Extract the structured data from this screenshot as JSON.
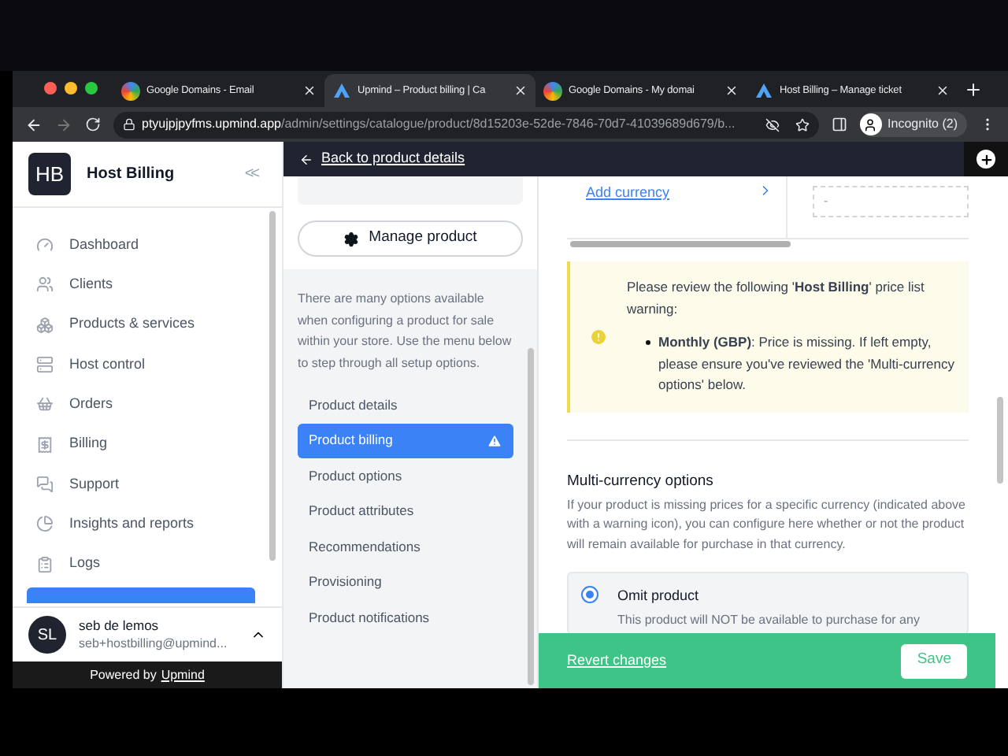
{
  "browser": {
    "tabs": [
      {
        "title": "Google Domains - Email",
        "kind": "google",
        "selected": false
      },
      {
        "title": "Upmind – Product billing | Ca",
        "kind": "upmind",
        "selected": true
      },
      {
        "title": "Google Domains - My domai",
        "kind": "google",
        "selected": false
      },
      {
        "title": "Host Billing – Manage ticket",
        "kind": "upmind",
        "selected": false
      }
    ],
    "address": {
      "host": "ptyujpjpyfms.upmind.app",
      "path": "/admin/settings/catalogue/product/8d15203e-52de-7846-70d7-41039689d679/b..."
    },
    "profile": "Incognito (2)"
  },
  "sidebar": {
    "logo": "HB",
    "brand": "Host Billing",
    "collapse": "<<",
    "items": [
      {
        "label": "Dashboard",
        "kind": "gauge"
      },
      {
        "label": "Clients",
        "kind": "users"
      },
      {
        "label": "Products & services",
        "kind": "boxes"
      },
      {
        "label": "Host control",
        "kind": "server"
      },
      {
        "label": "Orders",
        "kind": "basket"
      },
      {
        "label": "Billing",
        "kind": "receipt"
      },
      {
        "label": "Support",
        "kind": "chat"
      },
      {
        "label": "Insights and reports",
        "kind": "pie"
      },
      {
        "label": "Logs",
        "kind": "clipboard"
      }
    ],
    "user": {
      "initials": "SL",
      "name": "seb de lemos",
      "email": "seb+hostbilling@upmind..."
    },
    "footer": {
      "prefix": "Powered by",
      "link": "Upmind"
    }
  },
  "topbar": {
    "back": "Back to product details"
  },
  "product_menu": {
    "manage": "Manage product",
    "intro": "There are many options available when configuring a product for sale within your store. Use the menu below to step through all setup options.",
    "items": [
      {
        "label": "Product details",
        "selected": false,
        "warning": false
      },
      {
        "label": "Product billing",
        "selected": true,
        "warning": true
      },
      {
        "label": "Product options",
        "selected": false,
        "warning": false
      },
      {
        "label": "Product attributes",
        "selected": false,
        "warning": false
      },
      {
        "label": "Recommendations",
        "selected": false,
        "warning": false
      },
      {
        "label": "Provisioning",
        "selected": false,
        "warning": false
      },
      {
        "label": "Product notifications",
        "selected": false,
        "warning": false
      }
    ]
  },
  "content": {
    "add_currency": "Add currency",
    "price_cell": "-",
    "warning": {
      "intro": "Please review the following '**Host Billing**' price list warning:",
      "items": [
        "**Monthly (GBP)**: Price is missing. If left empty, please ensure you've reviewed the 'Multi-currency options' below."
      ]
    },
    "multi_currency": {
      "title": "Multi-currency options",
      "description": "If your product is missing prices for a specific currency (indicated above with a warning icon), you can configure here whether or not the product will remain available for purchase in that currency.",
      "options": [
        {
          "label": "Omit product",
          "description": "This product will NOT be available to purchase for any",
          "selected": true
        }
      ]
    }
  },
  "save_bar": {
    "revert": "Revert changes",
    "save": "Save"
  }
}
